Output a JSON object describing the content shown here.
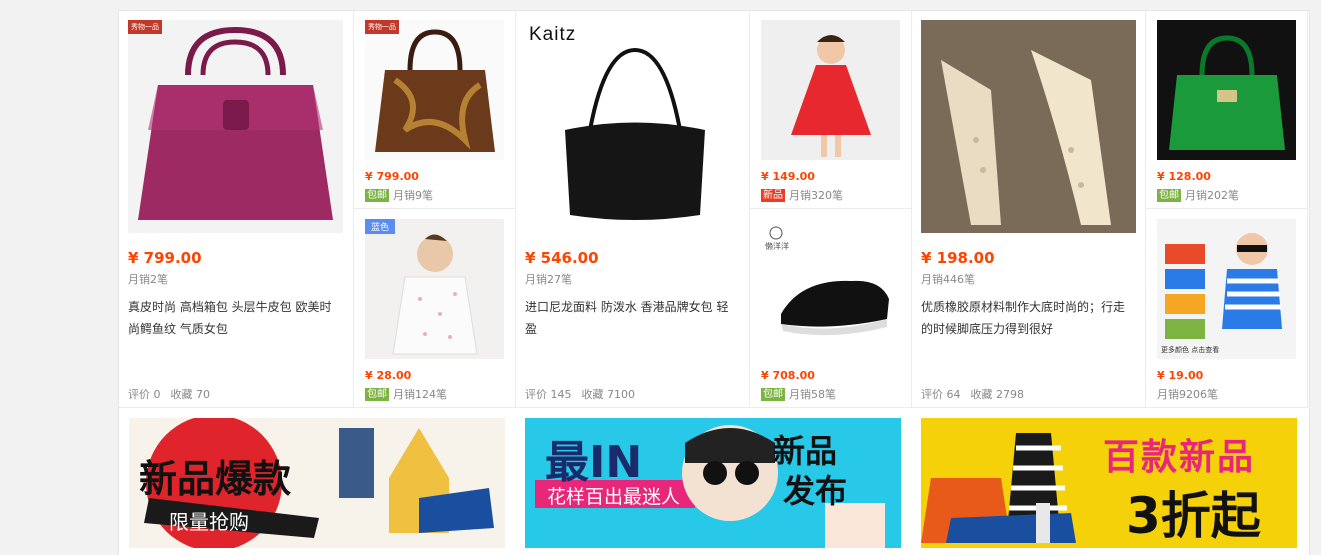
{
  "products": {
    "p1": {
      "price": "¥ 799.00",
      "sales": "月销2笔",
      "desc": "真皮时尚 高档箱包 头层牛皮包 欧美时尚鳄鱼纹 气质女包",
      "rating": "评价 0",
      "favorites": "收藏 70",
      "corner_logo": "秀物一品"
    },
    "p2": {
      "price": "¥ 799.00",
      "tag": "包邮",
      "sales": "月销9笔",
      "corner_logo": "秀物一品"
    },
    "p3": {
      "price": "¥ 28.00",
      "tag": "包邮",
      "sales": "月销124笔",
      "badge": "蓝色"
    },
    "p4": {
      "brand": "Kaitz",
      "price": "¥ 546.00",
      "sales": "月销27笔",
      "desc": "进口尼龙面料 防泼水 香港品牌女包 轻盈",
      "rating": "评价 145",
      "favorites": "收藏 7100"
    },
    "p5": {
      "price": "¥ 149.00",
      "tag": "新品",
      "sales": "月销320笔"
    },
    "p6": {
      "price": "¥ 708.00",
      "tag": "包邮",
      "sales": "月销58笔",
      "logo": "懒洋洋"
    },
    "p7": {
      "price": "¥ 198.00",
      "sales": "月销446笔",
      "desc": "优质橡胶原材料制作大底时尚的；行走的时候脚底压力得到很好",
      "rating": "评价 64",
      "favorites": "收藏 2798"
    },
    "p8": {
      "price": "¥ 128.00",
      "tag": "包邮",
      "sales": "月销202笔"
    },
    "p9": {
      "price": "¥ 19.00",
      "sales": "月销9206笔",
      "overlay": "更多颜色 点击查看"
    }
  },
  "banners": {
    "b1": {
      "title": "新品爆款",
      "subtitle": "限量抢购"
    },
    "b2": {
      "title": "最IN",
      "subtitle": "花样百出最迷人",
      "right1": "新品",
      "right2": "发布"
    },
    "b3": {
      "title": "百款新品",
      "subtitle": "3折起"
    }
  },
  "colors": {
    "price": "#ff4400",
    "tag_green": "#7cb342",
    "tag_red": "#ef3b24",
    "badge_blue": "#5b8def"
  }
}
